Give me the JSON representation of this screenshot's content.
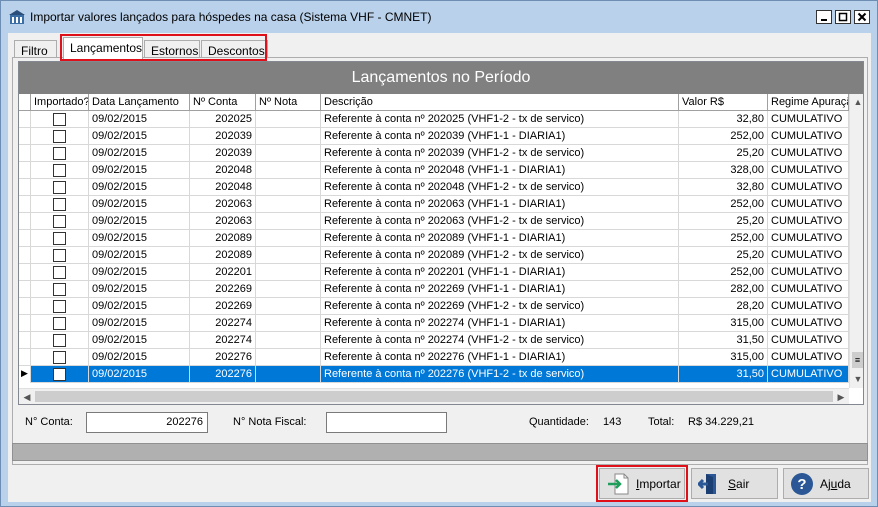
{
  "window": {
    "title": "Importar valores lançados para hóspedes na casa (Sistema VHF - CMNET)"
  },
  "tabs": [
    {
      "label": "Filtro"
    },
    {
      "label": "Lançamentos"
    },
    {
      "label": "Estornos"
    },
    {
      "label": "Descontos"
    }
  ],
  "grid": {
    "caption": "Lançamentos no Período",
    "columns": [
      "Importado?",
      "Data Lançamento",
      "Nº Conta",
      "Nº Nota",
      "Descrição",
      "Valor R$",
      "Regime Apuraçã"
    ],
    "rows": [
      {
        "data": "09/02/2015",
        "conta": "202025",
        "nota": "",
        "descricao": "Referente à conta nº 202025 (VHF1-2 - tx de servico)",
        "valor": "32,80",
        "regime": "CUMULATIVO"
      },
      {
        "data": "09/02/2015",
        "conta": "202039",
        "nota": "",
        "descricao": "Referente à conta nº 202039 (VHF1-1 - DIARIA1)",
        "valor": "252,00",
        "regime": "CUMULATIVO"
      },
      {
        "data": "09/02/2015",
        "conta": "202039",
        "nota": "",
        "descricao": "Referente à conta nº 202039 (VHF1-2 - tx de servico)",
        "valor": "25,20",
        "regime": "CUMULATIVO"
      },
      {
        "data": "09/02/2015",
        "conta": "202048",
        "nota": "",
        "descricao": "Referente à conta nº 202048 (VHF1-1 - DIARIA1)",
        "valor": "328,00",
        "regime": "CUMULATIVO"
      },
      {
        "data": "09/02/2015",
        "conta": "202048",
        "nota": "",
        "descricao": "Referente à conta nº 202048 (VHF1-2 - tx de servico)",
        "valor": "32,80",
        "regime": "CUMULATIVO"
      },
      {
        "data": "09/02/2015",
        "conta": "202063",
        "nota": "",
        "descricao": "Referente à conta nº 202063 (VHF1-1 - DIARIA1)",
        "valor": "252,00",
        "regime": "CUMULATIVO"
      },
      {
        "data": "09/02/2015",
        "conta": "202063",
        "nota": "",
        "descricao": "Referente à conta nº 202063 (VHF1-2 - tx de servico)",
        "valor": "25,20",
        "regime": "CUMULATIVO"
      },
      {
        "data": "09/02/2015",
        "conta": "202089",
        "nota": "",
        "descricao": "Referente à conta nº 202089 (VHF1-1 - DIARIA1)",
        "valor": "252,00",
        "regime": "CUMULATIVO"
      },
      {
        "data": "09/02/2015",
        "conta": "202089",
        "nota": "",
        "descricao": "Referente à conta nº 202089 (VHF1-2 - tx de servico)",
        "valor": "25,20",
        "regime": "CUMULATIVO"
      },
      {
        "data": "09/02/2015",
        "conta": "202201",
        "nota": "",
        "descricao": "Referente à conta nº 202201 (VHF1-1 - DIARIA1)",
        "valor": "252,00",
        "regime": "CUMULATIVO"
      },
      {
        "data": "09/02/2015",
        "conta": "202269",
        "nota": "",
        "descricao": "Referente à conta nº 202269 (VHF1-1 - DIARIA1)",
        "valor": "282,00",
        "regime": "CUMULATIVO"
      },
      {
        "data": "09/02/2015",
        "conta": "202269",
        "nota": "",
        "descricao": "Referente à conta nº 202269 (VHF1-2 - tx de servico)",
        "valor": "28,20",
        "regime": "CUMULATIVO"
      },
      {
        "data": "09/02/2015",
        "conta": "202274",
        "nota": "",
        "descricao": "Referente à conta nº 202274 (VHF1-1 - DIARIA1)",
        "valor": "315,00",
        "regime": "CUMULATIVO"
      },
      {
        "data": "09/02/2015",
        "conta": "202274",
        "nota": "",
        "descricao": "Referente à conta nº 202274 (VHF1-2 - tx de servico)",
        "valor": "31,50",
        "regime": "CUMULATIVO"
      },
      {
        "data": "09/02/2015",
        "conta": "202276",
        "nota": "",
        "descricao": "Referente à conta nº 202276 (VHF1-1 - DIARIA1)",
        "valor": "315,00",
        "regime": "CUMULATIVO"
      },
      {
        "data": "09/02/2015",
        "conta": "202276",
        "nota": "",
        "descricao": "Referente à conta nº 202276 (VHF1-2 - tx de servico)",
        "valor": "31,50",
        "regime": "CUMULATIVO"
      }
    ]
  },
  "footer": {
    "conta_label": "N° Conta:",
    "conta_value": "202276",
    "nota_label": "N° Nota Fiscal:",
    "nota_value": "",
    "quantidade_label": "Quantidade:",
    "quantidade_value": "143",
    "total_label": "Total:",
    "total_value": "R$ 34.229,21"
  },
  "buttons": {
    "importar_first": "I",
    "importar_rest": "mportar",
    "sair_first": "S",
    "sair_rest": "air",
    "ajuda_pre": "Aj",
    "ajuda_u": "u",
    "ajuda_post": "da"
  },
  "colors": {
    "selection": "#0078d7",
    "highlight_box": "#e0101a",
    "caption_bg": "#808080"
  }
}
